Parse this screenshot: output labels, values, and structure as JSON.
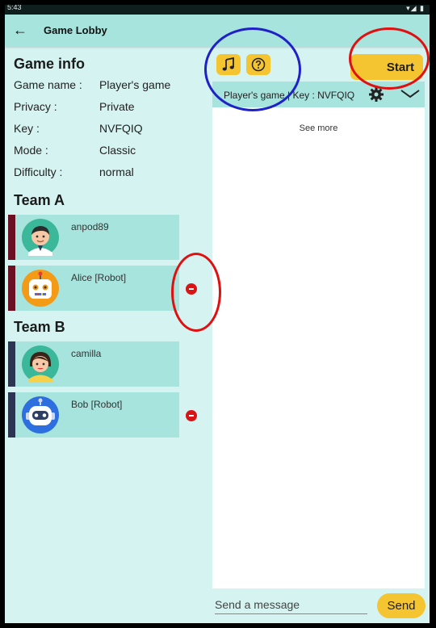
{
  "status_bar": {
    "time": "5:43",
    "icons": "▾◢ ▮"
  },
  "app_bar": {
    "back_icon": "arrow-left",
    "title": "Game Lobby"
  },
  "game_info": {
    "heading": "Game info",
    "rows": [
      {
        "key": "Game name :",
        "value": "Player's game"
      },
      {
        "key": "Privacy :",
        "value": "Private"
      },
      {
        "key": "Key :",
        "value": "NVFQIQ"
      },
      {
        "key": "Mode :",
        "value": "Classic"
      },
      {
        "key": "Difficulty :",
        "value": "normal"
      }
    ]
  },
  "team_a": {
    "heading": "Team A",
    "color": "#6b0f22",
    "players": [
      {
        "name": "anpod89",
        "avatar": "boy-avatar"
      },
      {
        "name": "Alice [Robot]",
        "avatar": "orange-robot-avatar"
      }
    ]
  },
  "team_b": {
    "heading": "Team B",
    "color": "#2b3450",
    "players": [
      {
        "name": "camilla",
        "avatar": "girl-avatar"
      },
      {
        "name": "Bob [Robot]",
        "avatar": "blue-robot-avatar"
      }
    ]
  },
  "toolbar": {
    "music_icon": "music-note-icon",
    "help_icon": "question-icon",
    "start_label": "Start"
  },
  "chat": {
    "header": "Player's game | Key : NVFQIQ",
    "see_more": "See more",
    "input_placeholder": "Send a message",
    "send_label": "Send"
  },
  "colors": {
    "accent": "#f4c431",
    "panel": "#a6e4dd",
    "background": "#d5f3f1",
    "annotation_red": "#e01010",
    "annotation_blue": "#2020c8"
  }
}
